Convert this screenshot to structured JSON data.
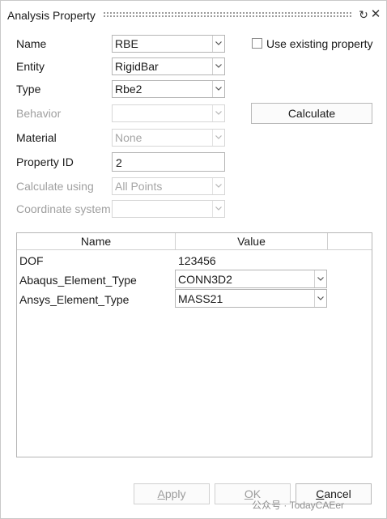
{
  "window": {
    "title": "Analysis Property",
    "restore_icon": "↻",
    "close_icon": "✕"
  },
  "form": {
    "name": {
      "label": "Name",
      "value": "RBE"
    },
    "entity": {
      "label": "Entity",
      "value": "RigidBar"
    },
    "type": {
      "label": "Type",
      "value": "Rbe2"
    },
    "behavior": {
      "label": "Behavior",
      "value": ""
    },
    "material": {
      "label": "Material",
      "value": "None"
    },
    "property_id": {
      "label": "Property ID",
      "value": "2"
    },
    "calculate_using": {
      "label": "Calculate using",
      "value": "All Points"
    },
    "coordinate_system": {
      "label": "Coordinate system",
      "value": ""
    },
    "use_existing": {
      "label": "Use existing property",
      "checked": false
    },
    "calculate_button": "Calculate"
  },
  "table": {
    "headers": [
      "Name",
      "Value"
    ],
    "rows": [
      {
        "name": "DOF",
        "value": "123456",
        "kind": "text"
      },
      {
        "name": "Abaqus_Element_Type",
        "value": "CONN3D2",
        "kind": "combo"
      },
      {
        "name": "Ansys_Element_Type",
        "value": "MASS21",
        "kind": "combo"
      }
    ]
  },
  "footer": {
    "apply": {
      "underline": "A",
      "rest": "pply"
    },
    "ok": {
      "underline": "O",
      "rest": "K"
    },
    "cancel": {
      "underline": "C",
      "rest": "ancel"
    }
  },
  "watermark": "公众号 · TodayCAEer"
}
